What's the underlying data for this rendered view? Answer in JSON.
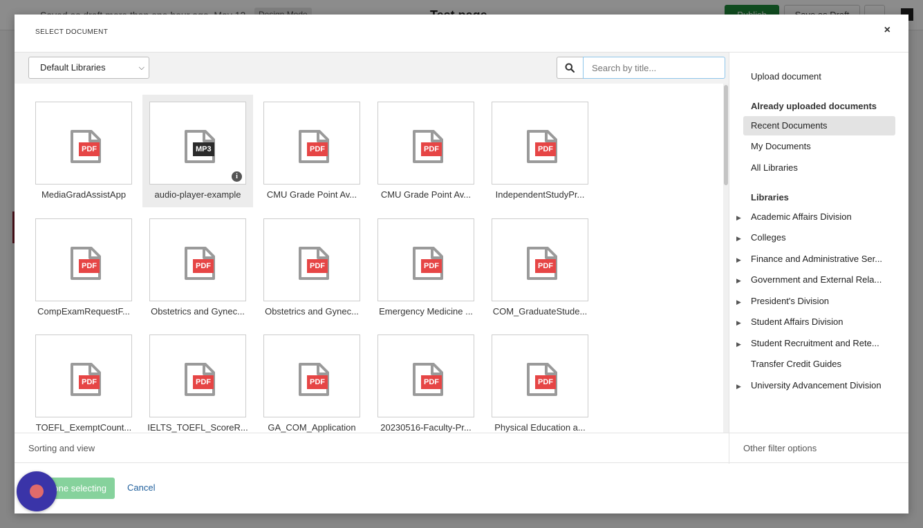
{
  "background": {
    "header_text": "Saved as draft more than one hour ago, May 12",
    "mode_badge": "Design Mode",
    "page_title": "Test page",
    "publish_label": "Publish",
    "save_label": "Save as Draft"
  },
  "modal": {
    "title": "SELECT DOCUMENT",
    "close_icon": "×"
  },
  "toolbar": {
    "library_select": {
      "selected": "Default Libraries"
    },
    "search": {
      "placeholder": "Search by title..."
    }
  },
  "documents": [
    {
      "label": "MediaGradAssistApp",
      "type": "PDF"
    },
    {
      "label": "audio-player-example",
      "type": "MP3",
      "selected": true,
      "info": "i"
    },
    {
      "label": "CMU Grade Point Av...",
      "type": "PDF"
    },
    {
      "label": "CMU Grade Point Av...",
      "type": "PDF"
    },
    {
      "label": "IndependentStudyPr...",
      "type": "PDF"
    },
    {
      "label": "CompExamRequestF...",
      "type": "PDF"
    },
    {
      "label": "Obstetrics and Gynec...",
      "type": "PDF"
    },
    {
      "label": "Obstetrics and Gynec...",
      "type": "PDF"
    },
    {
      "label": "Emergency Medicine ...",
      "type": "PDF"
    },
    {
      "label": "COM_GraduateStude...",
      "type": "PDF"
    },
    {
      "label": "TOEFL_ExemptCount...",
      "type": "PDF"
    },
    {
      "label": "IELTS_TOEFL_ScoreR...",
      "type": "PDF"
    },
    {
      "label": "GA_COM_Application",
      "type": "PDF"
    },
    {
      "label": "20230516-Faculty-Pr...",
      "type": "PDF"
    },
    {
      "label": "Physical Education a...",
      "type": "PDF"
    }
  ],
  "sidebar": {
    "upload": "Upload document",
    "uploaded_heading": "Already uploaded documents",
    "uploaded_items": [
      "Recent Documents",
      "My Documents",
      "All Libraries"
    ],
    "libraries_heading": "Libraries",
    "libraries": [
      {
        "label": "Academic Affairs Division",
        "expandable": true
      },
      {
        "label": "Colleges",
        "expandable": true
      },
      {
        "label": "Finance and Administrative Ser...",
        "expandable": true
      },
      {
        "label": "Government and External Rela...",
        "expandable": true
      },
      {
        "label": "President's Division",
        "expandable": true
      },
      {
        "label": "Student Affairs Division",
        "expandable": true
      },
      {
        "label": "Student Recruitment and Rete...",
        "expandable": true
      },
      {
        "label": "Transfer Credit Guides",
        "expandable": false
      },
      {
        "label": "University Advancement Division",
        "expandable": true
      }
    ]
  },
  "footer": {
    "sorting": "Sorting and view",
    "other_filters": "Other filter options",
    "done": "Done selecting",
    "cancel": "Cancel"
  },
  "colors": {
    "pdf_badge": "#e64545",
    "mp3_badge": "#2b2b2b",
    "done_button": "#86d29c",
    "cancel_link": "#1f5f9c",
    "record_widget": "#3a34a8"
  }
}
